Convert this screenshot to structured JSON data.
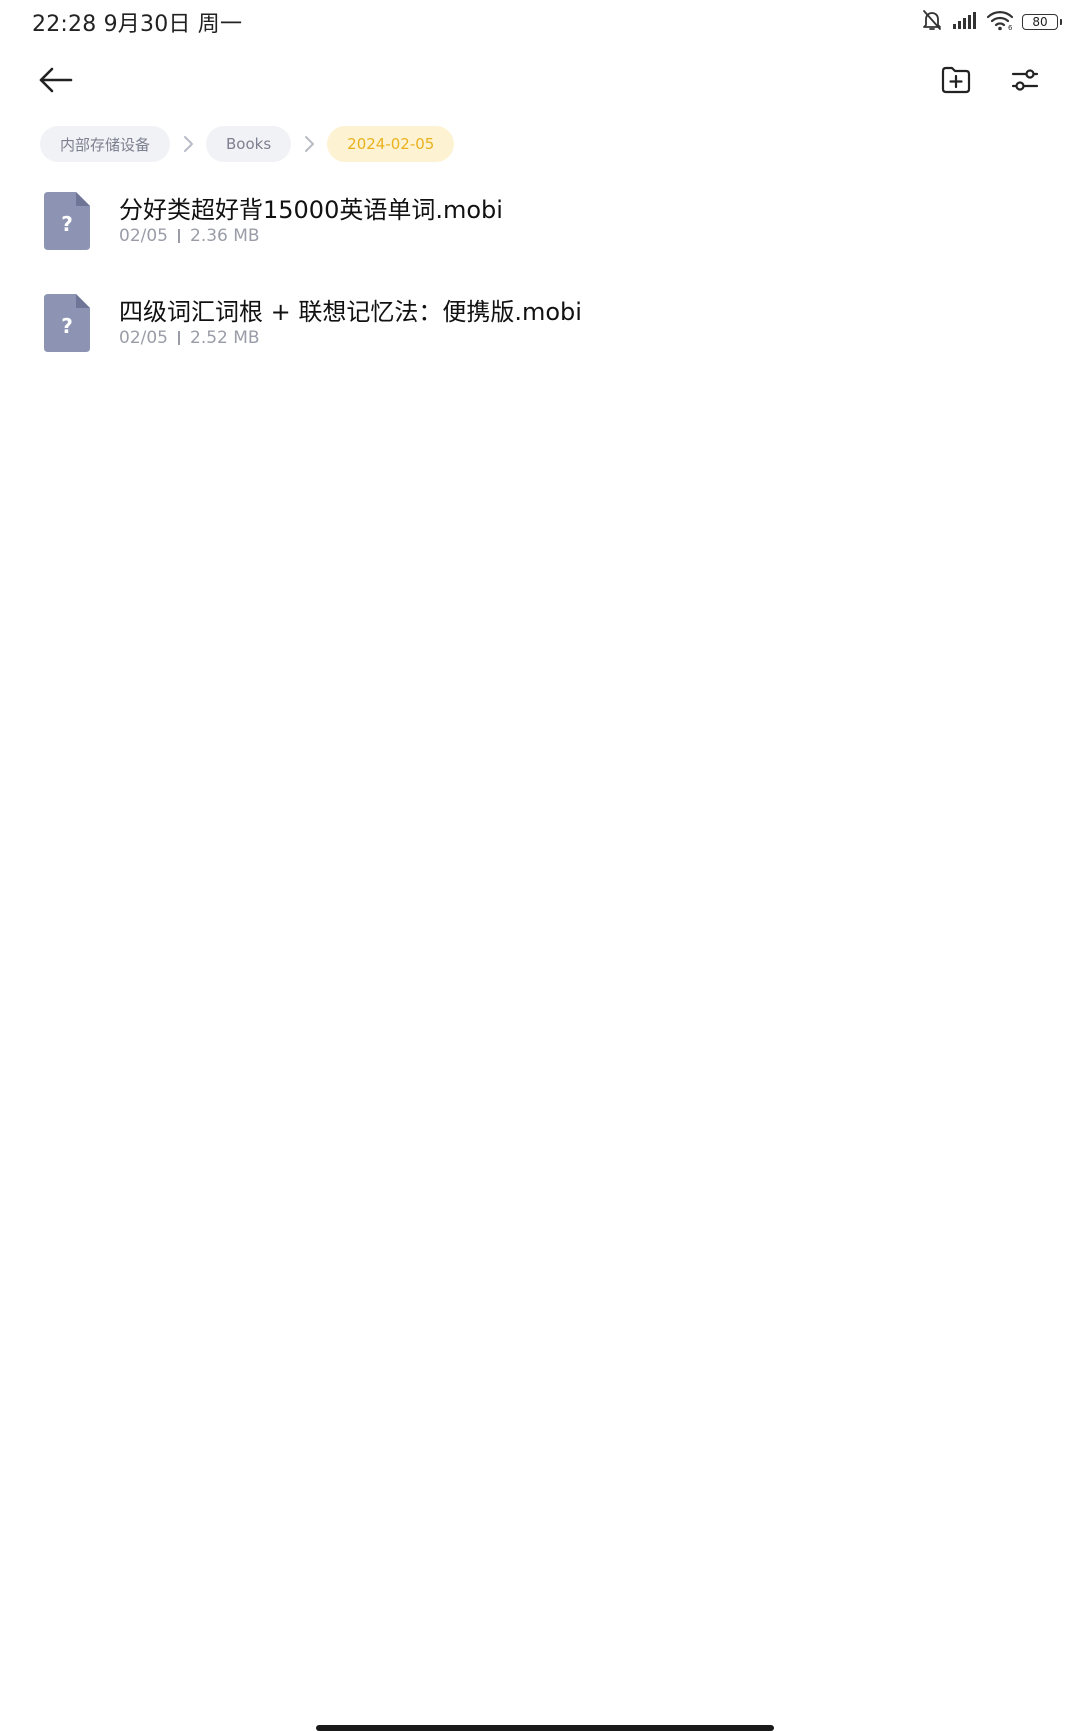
{
  "status_bar": {
    "time_date": "22:28  9月30日 周一",
    "battery_level": "80",
    "icons": [
      "mute-bell-icon",
      "cellular-signal-icon",
      "wifi-icon",
      "battery-icon"
    ]
  },
  "toolbar": {
    "back_icon": "arrow-left-icon",
    "new_folder_icon": "folder-plus-icon",
    "settings_icon": "sliders-icon"
  },
  "breadcrumb": {
    "items": [
      {
        "label": "内部存储设备"
      },
      {
        "label": "Books"
      },
      {
        "label": "2024-02-05"
      }
    ],
    "separator_icon": "chevron-right-icon",
    "active_color": "#e9b11d"
  },
  "files": [
    {
      "name": "分好类超好背15000英语单词.mobi",
      "date": "02/05",
      "size": "2.36 MB",
      "icon": "unknown-file-icon"
    },
    {
      "name": "四级词汇词根 + 联想记忆法：便携版.mobi",
      "date": "02/05",
      "size": "2.52 MB",
      "icon": "unknown-file-icon"
    }
  ],
  "colors": {
    "file_icon": "#8c93b3",
    "file_icon_fold": "#6e7597",
    "meta_text": "#9a9da8"
  }
}
